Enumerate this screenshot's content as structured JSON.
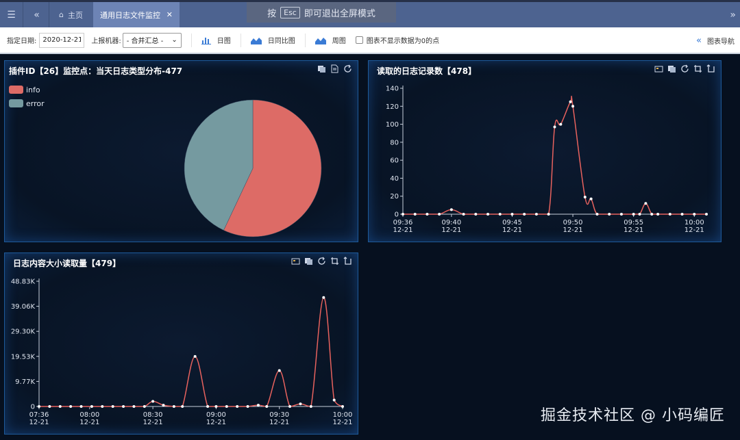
{
  "topbar": {
    "home_label": "主页",
    "active_tab_label": "通用日志文件监控",
    "esc_hint_prefix": "按",
    "esc_key": "Esc",
    "esc_hint_suffix": "即可退出全屏模式"
  },
  "toolbar": {
    "date_label": "指定日期:",
    "date_value": "2020-12-21",
    "machine_label": "上报机器:",
    "machine_value": "- 合并汇总 -",
    "btn_day": "日图",
    "btn_day_compare": "日同比图",
    "btn_week": "周图",
    "checkbox_label": "图表不显示数据为0的点",
    "nav_label": "图表导航"
  },
  "panels": {
    "pie": {
      "title": "插件ID【26】监控点：当天日志类型分布-477"
    },
    "records": {
      "title": "读取的日志记录数【478】"
    },
    "size": {
      "title": "日志内容大小读取量【479】"
    }
  },
  "watermark": "掘金技术社区 @ 小码编匠",
  "chart_data": [
    {
      "type": "pie",
      "legend": [
        "info",
        "error"
      ],
      "colors": [
        "#dd6b66",
        "#759aa0"
      ],
      "values": [
        57,
        43
      ]
    },
    {
      "type": "line",
      "color": "#e8625e",
      "ylim": [
        0,
        140
      ],
      "y_ticks": [
        "0",
        "20",
        "40",
        "60",
        "80",
        "100",
        "120",
        "140"
      ],
      "x_tick_labels": [
        {
          "time": "09:36",
          "date": "12-21",
          "min": 36
        },
        {
          "time": "09:40",
          "date": "12-21",
          "min": 40
        },
        {
          "time": "09:45",
          "date": "12-21",
          "min": 45
        },
        {
          "time": "09:50",
          "date": "12-21",
          "min": 50
        },
        {
          "time": "09:55",
          "date": "12-21",
          "min": 55
        },
        {
          "time": "10:00",
          "date": "12-21",
          "min": 60
        }
      ],
      "xlim": [
        36,
        61
      ],
      "points": [
        [
          36,
          0
        ],
        [
          37,
          0
        ],
        [
          38,
          0
        ],
        [
          39,
          0
        ],
        [
          40,
          5
        ],
        [
          41,
          0
        ],
        [
          42,
          0
        ],
        [
          43,
          0
        ],
        [
          44,
          0
        ],
        [
          45,
          0
        ],
        [
          46,
          0
        ],
        [
          47,
          0
        ],
        [
          48,
          0
        ],
        [
          48.5,
          97
        ],
        [
          49,
          100
        ],
        [
          49.8,
          125
        ],
        [
          50,
          120
        ],
        [
          51,
          19
        ],
        [
          51.5,
          17
        ],
        [
          52,
          0
        ],
        [
          53,
          0
        ],
        [
          54,
          0
        ],
        [
          55,
          0
        ],
        [
          55.5,
          0
        ],
        [
          56,
          12
        ],
        [
          56.5,
          0
        ],
        [
          57,
          0
        ],
        [
          58,
          0
        ],
        [
          59,
          0
        ],
        [
          60,
          0
        ],
        [
          61,
          0
        ]
      ]
    },
    {
      "type": "line",
      "color": "#e8625e",
      "ylim": [
        0,
        48830
      ],
      "y_ticks": [
        "0",
        "9.77K",
        "19.53K",
        "29.30K",
        "39.06K",
        "48.83K"
      ],
      "x_tick_labels": [
        {
          "time": "07:36",
          "date": "12-21",
          "min": 456
        },
        {
          "time": "08:00",
          "date": "12-21",
          "min": 480
        },
        {
          "time": "08:30",
          "date": "12-21",
          "min": 510
        },
        {
          "time": "09:00",
          "date": "12-21",
          "min": 540
        },
        {
          "time": "09:30",
          "date": "12-21",
          "min": 570
        },
        {
          "time": "10:00",
          "date": "12-21",
          "min": 600
        }
      ],
      "xlim": [
        456,
        600
      ],
      "points": [
        [
          456,
          0
        ],
        [
          461,
          0
        ],
        [
          466,
          0
        ],
        [
          471,
          0
        ],
        [
          476,
          0
        ],
        [
          481,
          0
        ],
        [
          486,
          0
        ],
        [
          491,
          0
        ],
        [
          496,
          0
        ],
        [
          501,
          0
        ],
        [
          506,
          0
        ],
        [
          510,
          2000
        ],
        [
          515,
          500
        ],
        [
          520,
          0
        ],
        [
          524,
          0
        ],
        [
          530,
          19500
        ],
        [
          536,
          0
        ],
        [
          540,
          0
        ],
        [
          545,
          0
        ],
        [
          550,
          0
        ],
        [
          555,
          0
        ],
        [
          560,
          500
        ],
        [
          564,
          0
        ],
        [
          570,
          14000
        ],
        [
          575,
          0
        ],
        [
          580,
          1000
        ],
        [
          585,
          0
        ],
        [
          591,
          42500
        ],
        [
          596,
          2500
        ],
        [
          600,
          0
        ]
      ]
    }
  ]
}
